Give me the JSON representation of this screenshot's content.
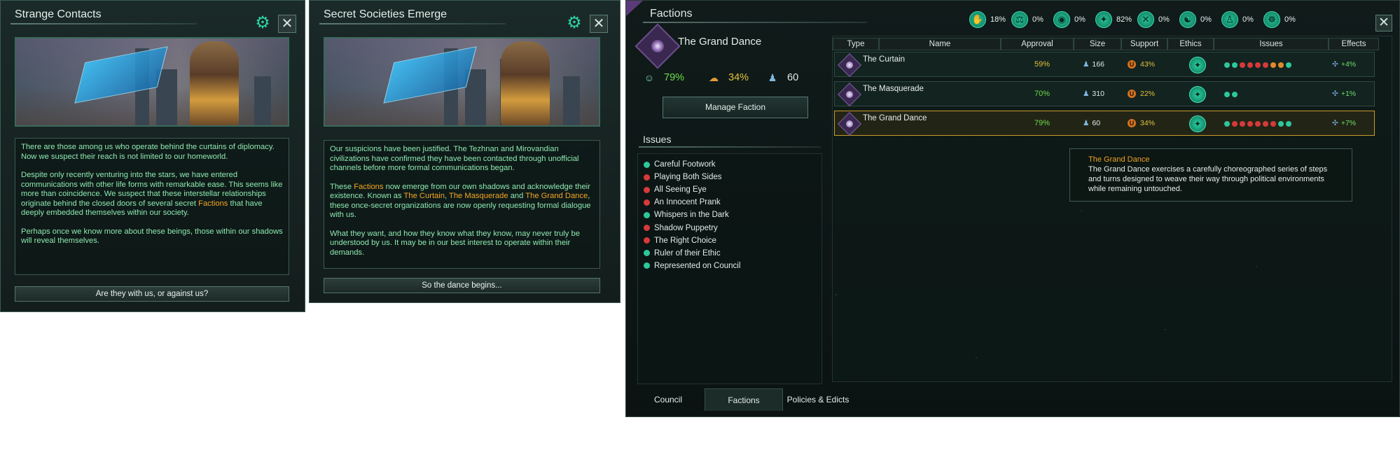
{
  "popup1": {
    "title": "Strange Contacts",
    "paragraphs": [
      [
        "There are those among us who operate behind the curtains of diplomacy. Now we suspect their reach is not limited to our homeworld."
      ],
      [
        "Despite only recently venturing into the stars, we have entered communications with other life forms with remarkable ease. This seems like more than coincidence. We suspect that these interstellar relationships originate behind the closed doors of several secret ",
        "Factions",
        " that have deeply embedded themselves within our society."
      ],
      [
        "Perhaps once we know more about these beings, those within our shadows will reveal themselves."
      ]
    ],
    "button": "Are they with us, or against us?"
  },
  "popup2": {
    "title": "Secret Societies Emerge",
    "paragraphs": [
      [
        "Our suspicions have been justified. The Tezhnan and Mirovandian civilizations have confirmed they have been contacted through unofficial channels before more formal communications began."
      ],
      [
        "These ",
        "Factions",
        " now emerge from our own shadows and acknowledge their existence. Known as ",
        "The Curtain",
        ", ",
        "The Masquerade",
        " and ",
        "The Grand Dance",
        ", these once-secret organizations are now openly requesting formal dialogue with us."
      ],
      [
        "What they want, and how they know what they know, may never truly be understood by us. It may be in our best interest to operate within their demands."
      ]
    ],
    "button": "So the dance begins..."
  },
  "factions_window": {
    "title": "Factions",
    "ethics_strip": [
      {
        "icon": "ethic-1-icon",
        "value": "18%"
      },
      {
        "icon": "ethic-2-icon",
        "value": "0%"
      },
      {
        "icon": "ethic-3-icon",
        "value": "0%"
      },
      {
        "icon": "ethic-4-icon",
        "value": "82%"
      },
      {
        "icon": "ethic-5-icon",
        "value": "0%"
      },
      {
        "icon": "ethic-6-icon",
        "value": "0%"
      },
      {
        "icon": "ethic-7-icon",
        "value": "0%"
      },
      {
        "icon": "ethic-8-icon",
        "value": "0%"
      }
    ],
    "selected": {
      "name": "The Grand Dance",
      "approval": "79%",
      "support": "34%",
      "size": "60"
    },
    "manage_button": "Manage Faction",
    "issues_heading": "Issues",
    "issues": [
      {
        "label": "Careful Footwork",
        "color": "#2ec79a"
      },
      {
        "label": "Playing Both Sides",
        "color": "#d63a3a"
      },
      {
        "label": "All Seeing Eye",
        "color": "#d63a3a"
      },
      {
        "label": "An Innocent Prank",
        "color": "#d63a3a"
      },
      {
        "label": "Whispers in the Dark",
        "color": "#2ec79a"
      },
      {
        "label": "Shadow Puppetry",
        "color": "#d63a3a"
      },
      {
        "label": "The Right Choice",
        "color": "#d63a3a"
      },
      {
        "label": "Ruler of their Ethic",
        "color": "#2ec79a"
      },
      {
        "label": "Represented on Council",
        "color": "#2ec79a"
      }
    ],
    "table": {
      "headers": [
        "Type",
        "Name",
        "Approval",
        "Size",
        "Support",
        "Ethics",
        "Issues",
        "Effects"
      ],
      "rows": [
        {
          "name": "The Curtain",
          "approval": "59%",
          "approval_color": "#e0c23a",
          "size": "166",
          "support": "43%",
          "effect": "+4%",
          "issue_colors": [
            "#2ec79a",
            "#2ec79a",
            "#d63a3a",
            "#d63a3a",
            "#d63a3a",
            "#d63a3a",
            "#e08a2a",
            "#e08a2a",
            "#2ec79a"
          ]
        },
        {
          "name": "The Masquerade",
          "approval": "70%",
          "approval_color": "#6fdc4c",
          "size": "310",
          "support": "22%",
          "effect": "+1%",
          "issue_colors": [
            "#2ec79a",
            "#2ec79a"
          ]
        },
        {
          "name": "The Grand Dance",
          "approval": "79%",
          "approval_color": "#6fdc4c",
          "size": "60",
          "support": "34%",
          "effect": "+7%",
          "issue_colors": [
            "#2ec79a",
            "#d63a3a",
            "#d63a3a",
            "#d63a3a",
            "#d63a3a",
            "#d63a3a",
            "#d63a3a",
            "#2ec79a",
            "#2ec79a"
          ]
        }
      ]
    },
    "tooltip": {
      "title": "The Grand Dance",
      "text": "The Grand Dance exercises a carefully choreographed series of steps and turns designed to weave their way through political environments while remaining untouched."
    },
    "tabs": [
      "Council",
      "Factions",
      "Policies & Edicts"
    ]
  }
}
